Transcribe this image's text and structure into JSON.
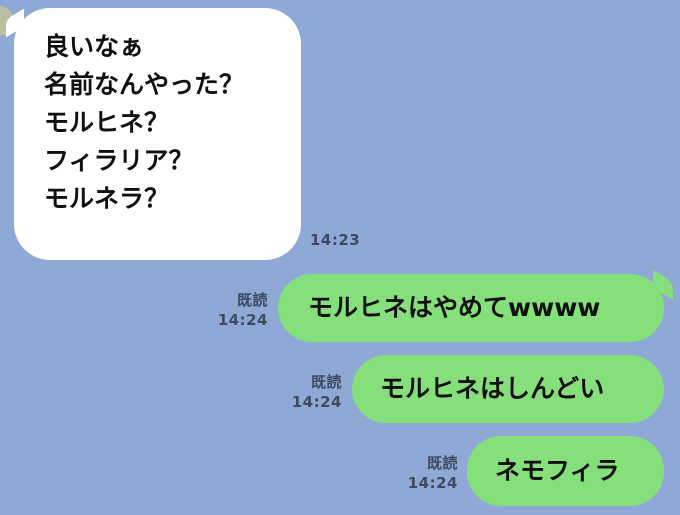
{
  "chat": {
    "incoming": {
      "text": "良いなぁ\n名前なんやった？\nモルヒネ？\nフィラリア？\nモルネラ？",
      "time": "14:23"
    },
    "outgoing": [
      {
        "text": "モルヒネはやめてwwww",
        "read": "既読",
        "time": "14:24"
      },
      {
        "text": "モルヒネはしんどい",
        "read": "既読",
        "time": "14:24"
      },
      {
        "text": "ネモフィラ",
        "read": "既読",
        "time": "14:24"
      }
    ]
  },
  "colors": {
    "background": "#8fa8d6",
    "incoming_bubble": "#ffffff",
    "outgoing_bubble": "#85e07b",
    "meta_text": "#3d4a62"
  },
  "icons": {
    "partner_avatar": "avatar-icon"
  }
}
